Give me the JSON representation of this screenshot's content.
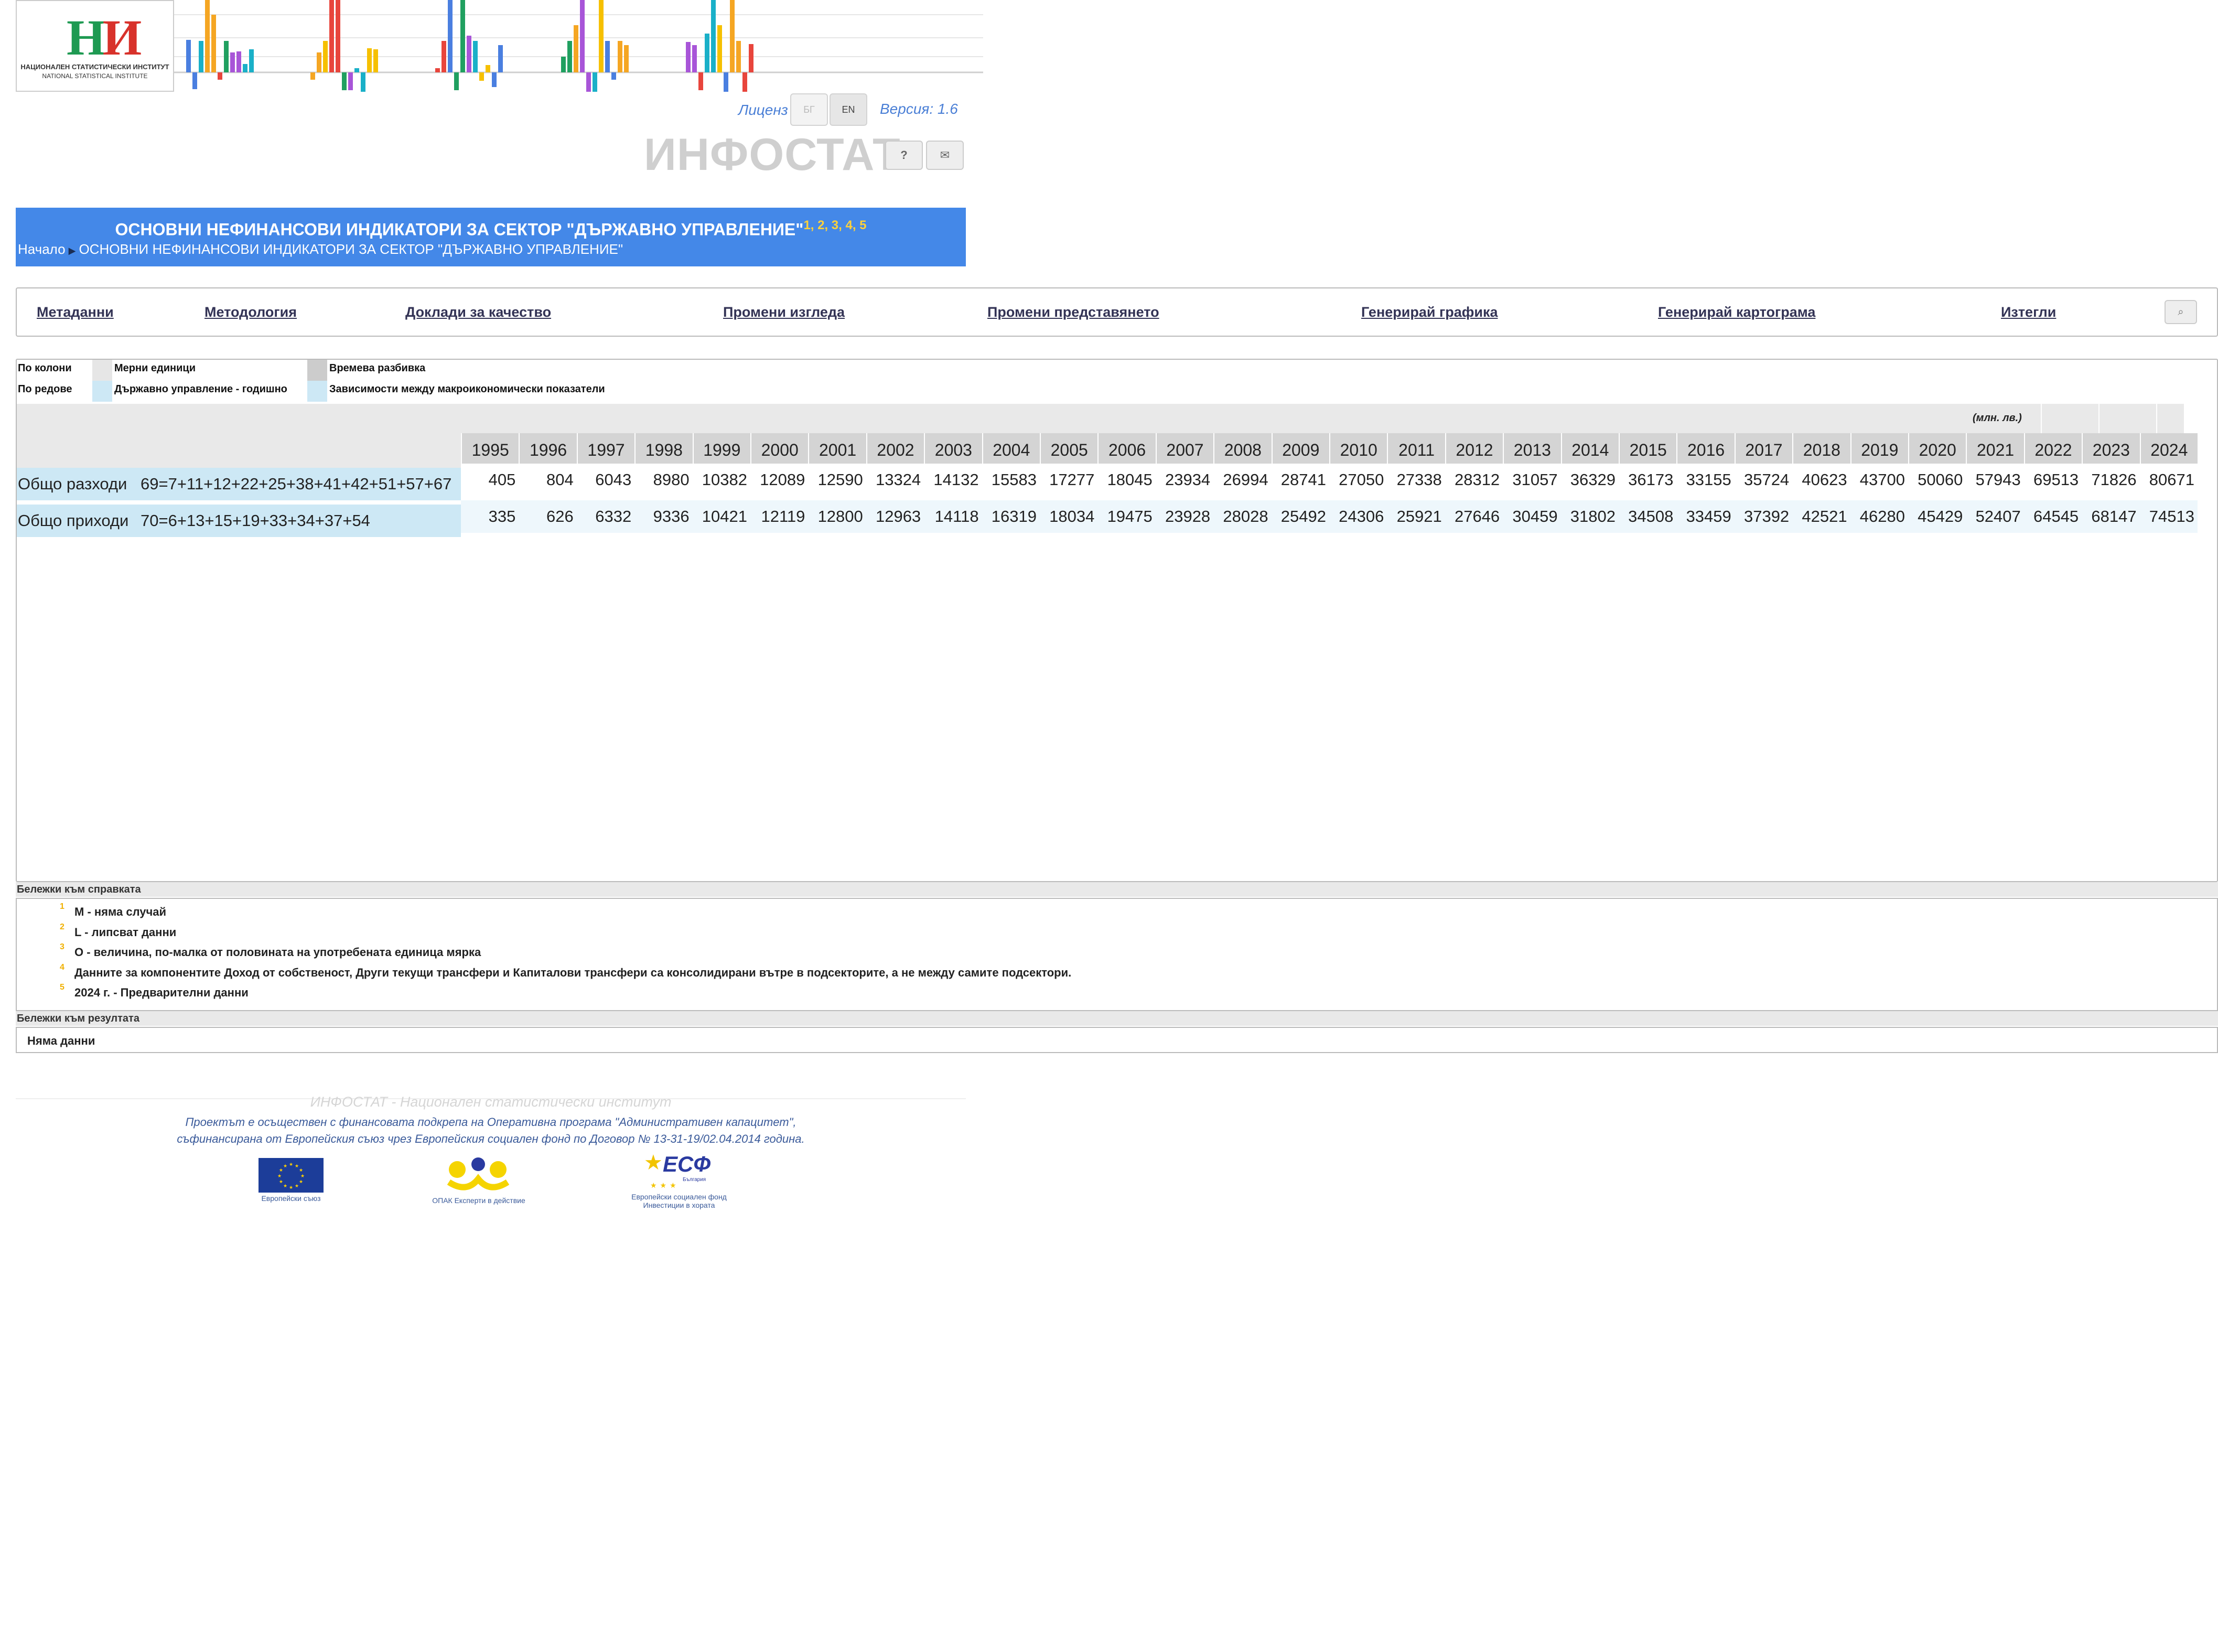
{
  "header": {
    "org_name_bg": "НАЦИОНАЛЕН СТАТИСТИЧЕСКИ ИНСТИТУТ",
    "org_name_en": "NATIONAL STATISTICAL INSTITUTE",
    "license_link": "Лиценз",
    "lang_bg": "БГ",
    "lang_en": "EN",
    "version": "Версия: 1.6",
    "brand": "ИНФОСТАТ",
    "help_label": "?",
    "mail_label": "✉"
  },
  "title_panel": {
    "title": "ОСНОВНИ НЕФИНАНСОВИ ИНДИКАТОРИ ЗА СЕКТОР \"ДЪРЖАВНО УПРАВЛЕНИЕ\"",
    "footnote_refs": "1, 2, 3, 4, 5",
    "breadcrumb_home": "Начало",
    "breadcrumb_current": "ОСНОВНИ НЕФИНАНСОВИ ИНДИКАТОРИ ЗА СЕКТОР \"ДЪРЖАВНО УПРАВЛЕНИЕ\""
  },
  "actions": [
    "Метаданни",
    "Методология",
    "Доклади за качество",
    "Промени изгледа",
    "Промени представянето",
    "Генерирай графика",
    "Генерирай картограма",
    "Изтегли"
  ],
  "search_icon": "⌕",
  "dimensions": {
    "by_columns_label": "По колони",
    "by_rows_label": "По редове",
    "col_dim_1": "Мерни единици",
    "col_dim_2": "Времева разбивка",
    "row_dim_1": "Държавно управление - годишно",
    "row_dim_2": "Зависимости между макроикономически показатели",
    "swatch_colors": [
      "#e6e6e6",
      "#cccccc",
      "#cde8f5",
      "#cde8f5"
    ]
  },
  "table": {
    "unit": "(млн. лв.)",
    "years": [
      "1995",
      "1996",
      "1997",
      "1998",
      "1999",
      "2000",
      "2001",
      "2002",
      "2003",
      "2004",
      "2005",
      "2006",
      "2007",
      "2008",
      "2009",
      "2010",
      "2011",
      "2012",
      "2013",
      "2014",
      "2015",
      "2016",
      "2017",
      "2018",
      "2019",
      "2020",
      "2021",
      "2022",
      "2023",
      "2024"
    ],
    "rows": [
      {
        "label": "Общо разходи",
        "formula": "69=7+11+12+22+25+38+41+42+51+57+67",
        "values": [
          "405",
          "804",
          "6043",
          "8980",
          "10382",
          "12089",
          "12590",
          "13324",
          "14132",
          "15583",
          "17277",
          "18045",
          "23934",
          "26994",
          "28741",
          "27050",
          "27338",
          "28312",
          "31057",
          "36329",
          "36173",
          "33155",
          "35724",
          "40623",
          "43700",
          "50060",
          "57943",
          "69513",
          "71826",
          "80671"
        ]
      },
      {
        "label": "Общо приходи",
        "formula": "70=6+13+15+19+33+34+37+54",
        "values": [
          "335",
          "626",
          "6332",
          "9336",
          "10421",
          "12119",
          "12800",
          "12963",
          "14118",
          "16319",
          "18034",
          "19475",
          "23928",
          "28028",
          "25492",
          "24306",
          "25921",
          "27646",
          "30459",
          "31802",
          "34508",
          "33459",
          "37392",
          "42521",
          "46280",
          "45429",
          "52407",
          "64545",
          "68147",
          "74513"
        ]
      }
    ]
  },
  "report_notes": {
    "heading": "Бележки към справката",
    "items": [
      {
        "num": "1",
        "text": "M - няма случай"
      },
      {
        "num": "2",
        "text": "L - липсват данни"
      },
      {
        "num": "3",
        "text": "O - величина, по-малка от половината на употребената единица мярка"
      },
      {
        "num": "4",
        "text": "Данните за компонентите Доход от собственост, Други текущи трансфери и Капиталови трансфери са консолидирани вътре в подсекторите, а не между самите подсектори."
      },
      {
        "num": "5",
        "text": "2024 г. - Предварителни данни"
      }
    ]
  },
  "result_notes": {
    "heading": "Бележки към резултата",
    "text": "Няма данни"
  },
  "footer": {
    "brand": "ИНФОСТАТ - Национален статистически институт",
    "credit_line1": "Проектът е осъществен с финансовата подкрепа на Оперативна програма \"Административен капацитет\",",
    "credit_line2": "съфинансирана от Европейския съюз чрез Европейския социален фонд по Договор № 13-31-19/02.04.2014 година.",
    "sponsor_eu": "Европейски съюз",
    "sponsor_opak": "ОПАК Експерти в действие",
    "sponsor_esf_mark": "ЕСФ",
    "sponsor_esf_country": "България",
    "sponsor_esf_1": "Европейски социален фонд",
    "sponsor_esf_2": "Инвестиции в хората"
  },
  "banner_colors": [
    "#4a7fe0",
    "#f5a623",
    "#e8453c",
    "#20a060",
    "#a855d8",
    "#1ab0c8",
    "#f6c000"
  ]
}
